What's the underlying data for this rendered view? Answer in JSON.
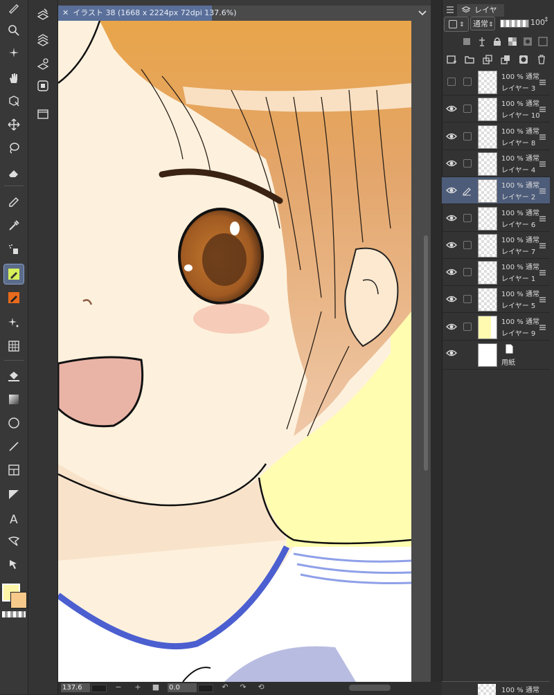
{
  "document": {
    "tab_title": "イラスト 38 (1668 x 2224px 72dpi 137.6%)",
    "close_icon": "close-icon"
  },
  "status": {
    "zoom": "137.6",
    "rotation": "0.0"
  },
  "layer_panel": {
    "tab_label": "レイヤー",
    "blend_mode": "通常",
    "opacity_value": "100",
    "layers": [
      {
        "opacity": "100 %  通常",
        "name": "レイヤー 3",
        "visible": false,
        "selected": false,
        "kind": "transparent"
      },
      {
        "opacity": "100 %  通常",
        "name": "レイヤー 10",
        "visible": true,
        "selected": false,
        "kind": "transparent"
      },
      {
        "opacity": "100 %  通常",
        "name": "レイヤー 8",
        "visible": true,
        "selected": false,
        "kind": "transparent"
      },
      {
        "opacity": "100 %  通常",
        "name": "レイヤー 4",
        "visible": true,
        "selected": false,
        "kind": "transparent"
      },
      {
        "opacity": "100 %  通常",
        "name": "レイヤー 2",
        "visible": true,
        "selected": true,
        "kind": "transparent"
      },
      {
        "opacity": "100 %  通常",
        "name": "レイヤー 6",
        "visible": true,
        "selected": false,
        "kind": "transparent"
      },
      {
        "opacity": "100 %  通常",
        "name": "レイヤー 7",
        "visible": true,
        "selected": false,
        "kind": "transparent"
      },
      {
        "opacity": "100 %  通常",
        "name": "レイヤー 1",
        "visible": true,
        "selected": false,
        "kind": "transparent"
      },
      {
        "opacity": "100 %  通常",
        "name": "レイヤー 5",
        "visible": true,
        "selected": false,
        "kind": "transparent"
      },
      {
        "opacity": "100 %  通常",
        "name": "レイヤー 9",
        "visible": true,
        "selected": false,
        "kind": "yellow"
      }
    ],
    "paper_layer": {
      "name": "用紙"
    },
    "bottom_layer_opacity": "100 %  通常"
  },
  "colors": {
    "main_color": "#fff6a8",
    "sub_color": "#f7c98a",
    "background_canvas": "#fffdb0",
    "accent_selected": "#4d5c79",
    "tab_accent": "#5a6f99"
  },
  "tools": [
    "magnifier-icon",
    "auto-select-icon",
    "hand-icon",
    "object-icon",
    "move-icon",
    "lasso-icon",
    "eraser-icon",
    "pencil-icon",
    "eyedropper-icon",
    "spray-icon",
    "pen-icon",
    "marker-icon",
    "decoration-icon",
    "perspective-ruler-icon",
    "fill-icon",
    "gradient-icon",
    "ellipse-icon",
    "line-icon",
    "frame-icon",
    "ruler-icon",
    "text-icon",
    "balloon-icon",
    "correct-line-icon"
  ]
}
